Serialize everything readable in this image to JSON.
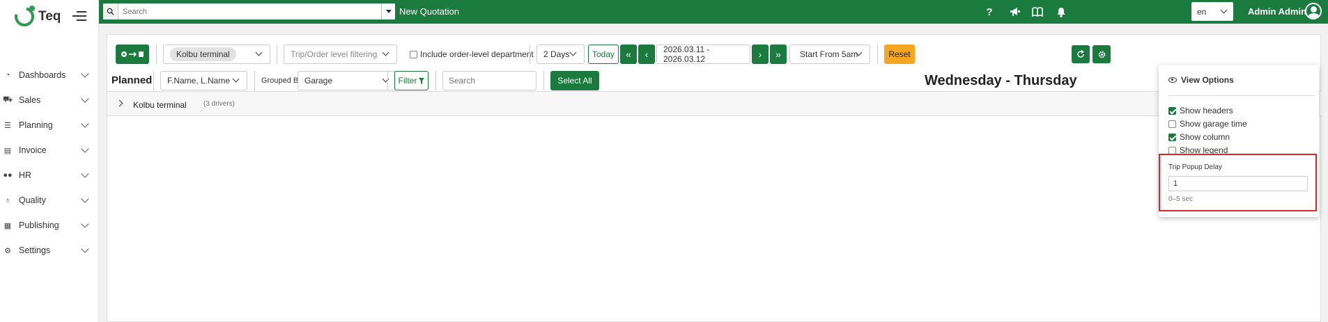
{
  "brand": {
    "name": "Teq"
  },
  "sidebar": {
    "items": [
      {
        "label": "Dashboards",
        "icon": "dashboard-icon"
      },
      {
        "label": "Sales",
        "icon": "cart-icon"
      },
      {
        "label": "Planning",
        "icon": "planning-icon"
      },
      {
        "label": "Invoice",
        "icon": "invoice-icon"
      },
      {
        "label": "HR",
        "icon": "people-icon"
      },
      {
        "label": "Quality",
        "icon": "quality-icon"
      },
      {
        "label": "Publishing",
        "icon": "publishing-icon"
      },
      {
        "label": "Settings",
        "icon": "gear-icon"
      }
    ]
  },
  "topbar": {
    "search_placeholder": "Search",
    "new_quotation": "New Quotation",
    "help": "?",
    "language": "en",
    "user_name": "Admin Admin",
    "color": "#1b7a3d"
  },
  "toolbar": {
    "terminal": "Kolbu terminal",
    "trip_filter_placeholder": "Trip/Order level filtering",
    "include_department": "Include order-level department",
    "days": "2 Days",
    "today": "Today",
    "date_range": "2026.03.11 - 2026.03.12",
    "start_from": "Start From 5am",
    "reset": "Reset",
    "planned": "Planned",
    "name_format": "F.Name, L.Name",
    "grouped_by_label": "Grouped By",
    "grouped_by": "Garage",
    "filter": "Filter",
    "search_placeholder": "Search",
    "select_all": "Select All",
    "day_title": "Wednesday - Thursday"
  },
  "group": {
    "name": "Kolbu terminal",
    "count": "(3 drivers)"
  },
  "view_options": {
    "title": "View Options",
    "options": [
      {
        "label": "Show headers",
        "checked": true
      },
      {
        "label": "Show garage time",
        "checked": false
      },
      {
        "label": "Show column",
        "checked": true
      },
      {
        "label": "Show legend",
        "checked": false
      }
    ],
    "delay_label": "Trip Popup Delay",
    "delay_value": "1",
    "delay_hint": "0–5 sec"
  }
}
